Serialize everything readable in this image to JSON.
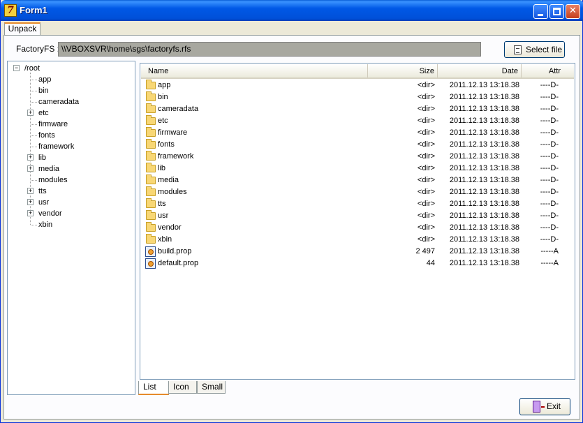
{
  "window": {
    "title": "Form1",
    "controls": {
      "minimize": "minimize-icon",
      "maximize": "maximize-icon",
      "close": "close-icon"
    }
  },
  "top_tabs": [
    {
      "label": "Unpack",
      "active": true
    }
  ],
  "path": {
    "label": "FactoryFS :",
    "value": "\\\\VBOXSVR\\home\\sgs\\factoryfs.rfs"
  },
  "select_button": {
    "label": "Select file",
    "icon": "document-icon"
  },
  "tree": {
    "root": {
      "label": "/root",
      "expanded": true
    },
    "children": [
      {
        "label": "app",
        "expandable": false
      },
      {
        "label": "bin",
        "expandable": false
      },
      {
        "label": "cameradata",
        "expandable": false
      },
      {
        "label": "etc",
        "expandable": true
      },
      {
        "label": "firmware",
        "expandable": false
      },
      {
        "label": "fonts",
        "expandable": false
      },
      {
        "label": "framework",
        "expandable": false
      },
      {
        "label": "lib",
        "expandable": true
      },
      {
        "label": "media",
        "expandable": true
      },
      {
        "label": "modules",
        "expandable": false
      },
      {
        "label": "tts",
        "expandable": true
      },
      {
        "label": "usr",
        "expandable": true
      },
      {
        "label": "vendor",
        "expandable": true
      },
      {
        "label": "xbin",
        "expandable": false
      }
    ]
  },
  "list": {
    "columns": {
      "name": "Name",
      "size": "Size",
      "date": "Date",
      "attr": "Attr"
    },
    "rows": [
      {
        "icon": "folder-icon",
        "name": "app",
        "size": "<dir>",
        "date": "2011.12.13 13:18.38",
        "attr": "----D-"
      },
      {
        "icon": "folder-icon",
        "name": "bin",
        "size": "<dir>",
        "date": "2011.12.13 13:18.38",
        "attr": "----D-"
      },
      {
        "icon": "folder-icon",
        "name": "cameradata",
        "size": "<dir>",
        "date": "2011.12.13 13:18.38",
        "attr": "----D-"
      },
      {
        "icon": "folder-icon",
        "name": "etc",
        "size": "<dir>",
        "date": "2011.12.13 13:18.38",
        "attr": "----D-"
      },
      {
        "icon": "folder-icon",
        "name": "firmware",
        "size": "<dir>",
        "date": "2011.12.13 13:18.38",
        "attr": "----D-"
      },
      {
        "icon": "folder-icon",
        "name": "fonts",
        "size": "<dir>",
        "date": "2011.12.13 13:18.38",
        "attr": "----D-"
      },
      {
        "icon": "folder-icon",
        "name": "framework",
        "size": "<dir>",
        "date": "2011.12.13 13:18.38",
        "attr": "----D-"
      },
      {
        "icon": "folder-icon",
        "name": "lib",
        "size": "<dir>",
        "date": "2011.12.13 13:18.38",
        "attr": "----D-"
      },
      {
        "icon": "folder-icon",
        "name": "media",
        "size": "<dir>",
        "date": "2011.12.13 13:18.38",
        "attr": "----D-"
      },
      {
        "icon": "folder-icon",
        "name": "modules",
        "size": "<dir>",
        "date": "2011.12.13 13:18.38",
        "attr": "----D-"
      },
      {
        "icon": "folder-icon",
        "name": "tts",
        "size": "<dir>",
        "date": "2011.12.13 13:18.38",
        "attr": "----D-"
      },
      {
        "icon": "folder-icon",
        "name": "usr",
        "size": "<dir>",
        "date": "2011.12.13 13:18.38",
        "attr": "----D-"
      },
      {
        "icon": "folder-icon",
        "name": "vendor",
        "size": "<dir>",
        "date": "2011.12.13 13:18.38",
        "attr": "----D-"
      },
      {
        "icon": "folder-icon",
        "name": "xbin",
        "size": "<dir>",
        "date": "2011.12.13 13:18.38",
        "attr": "----D-"
      },
      {
        "icon": "file-icon",
        "name": "build.prop",
        "size": "2 497",
        "date": "2011.12.13 13:18.38",
        "attr": "-----A"
      },
      {
        "icon": "file-icon",
        "name": "default.prop",
        "size": "44",
        "date": "2011.12.13 13:18.38",
        "attr": "-----A"
      }
    ]
  },
  "view_tabs": [
    {
      "label": "List",
      "active": true
    },
    {
      "label": "Icon",
      "active": false
    },
    {
      "label": "Small",
      "active": false
    }
  ],
  "exit_button": {
    "label": "Exit",
    "icon": "exit-door-icon"
  },
  "colors": {
    "titlebar": "#0058e6",
    "path_field_bg": "#a8a8a0",
    "folder": "#f8d775",
    "active_tab_accent": "#e68b2c"
  }
}
